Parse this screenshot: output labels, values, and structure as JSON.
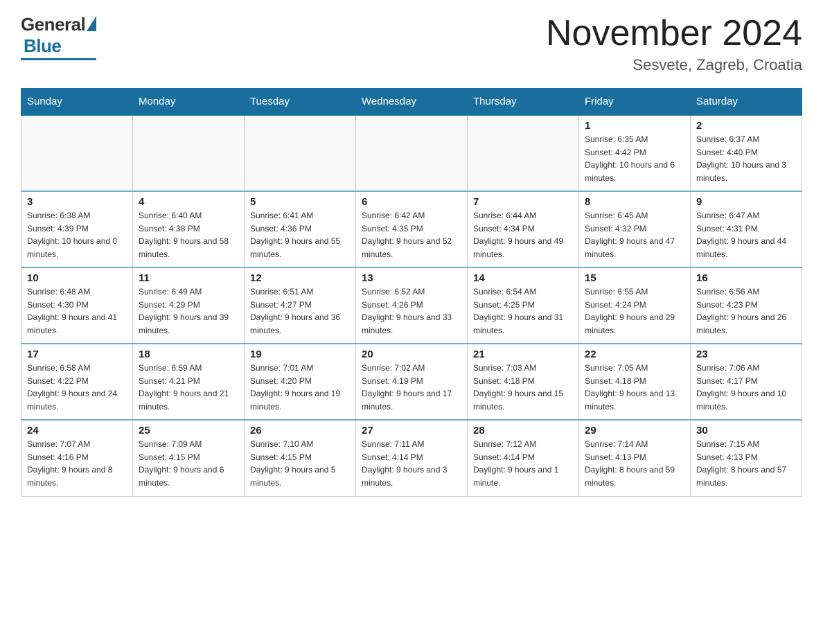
{
  "logo": {
    "general": "General",
    "blue": "Blue"
  },
  "header": {
    "month": "November 2024",
    "location": "Sesvete, Zagreb, Croatia"
  },
  "days_of_week": [
    "Sunday",
    "Monday",
    "Tuesday",
    "Wednesday",
    "Thursday",
    "Friday",
    "Saturday"
  ],
  "weeks": [
    [
      {
        "day": "",
        "info": ""
      },
      {
        "day": "",
        "info": ""
      },
      {
        "day": "",
        "info": ""
      },
      {
        "day": "",
        "info": ""
      },
      {
        "day": "",
        "info": ""
      },
      {
        "day": "1",
        "info": "Sunrise: 6:35 AM\nSunset: 4:42 PM\nDaylight: 10 hours and 6 minutes."
      },
      {
        "day": "2",
        "info": "Sunrise: 6:37 AM\nSunset: 4:40 PM\nDaylight: 10 hours and 3 minutes."
      }
    ],
    [
      {
        "day": "3",
        "info": "Sunrise: 6:38 AM\nSunset: 4:39 PM\nDaylight: 10 hours and 0 minutes."
      },
      {
        "day": "4",
        "info": "Sunrise: 6:40 AM\nSunset: 4:38 PM\nDaylight: 9 hours and 58 minutes."
      },
      {
        "day": "5",
        "info": "Sunrise: 6:41 AM\nSunset: 4:36 PM\nDaylight: 9 hours and 55 minutes."
      },
      {
        "day": "6",
        "info": "Sunrise: 6:42 AM\nSunset: 4:35 PM\nDaylight: 9 hours and 52 minutes."
      },
      {
        "day": "7",
        "info": "Sunrise: 6:44 AM\nSunset: 4:34 PM\nDaylight: 9 hours and 49 minutes."
      },
      {
        "day": "8",
        "info": "Sunrise: 6:45 AM\nSunset: 4:32 PM\nDaylight: 9 hours and 47 minutes."
      },
      {
        "day": "9",
        "info": "Sunrise: 6:47 AM\nSunset: 4:31 PM\nDaylight: 9 hours and 44 minutes."
      }
    ],
    [
      {
        "day": "10",
        "info": "Sunrise: 6:48 AM\nSunset: 4:30 PM\nDaylight: 9 hours and 41 minutes."
      },
      {
        "day": "11",
        "info": "Sunrise: 6:49 AM\nSunset: 4:29 PM\nDaylight: 9 hours and 39 minutes."
      },
      {
        "day": "12",
        "info": "Sunrise: 6:51 AM\nSunset: 4:27 PM\nDaylight: 9 hours and 36 minutes."
      },
      {
        "day": "13",
        "info": "Sunrise: 6:52 AM\nSunset: 4:26 PM\nDaylight: 9 hours and 33 minutes."
      },
      {
        "day": "14",
        "info": "Sunrise: 6:54 AM\nSunset: 4:25 PM\nDaylight: 9 hours and 31 minutes."
      },
      {
        "day": "15",
        "info": "Sunrise: 6:55 AM\nSunset: 4:24 PM\nDaylight: 9 hours and 29 minutes."
      },
      {
        "day": "16",
        "info": "Sunrise: 6:56 AM\nSunset: 4:23 PM\nDaylight: 9 hours and 26 minutes."
      }
    ],
    [
      {
        "day": "17",
        "info": "Sunrise: 6:58 AM\nSunset: 4:22 PM\nDaylight: 9 hours and 24 minutes."
      },
      {
        "day": "18",
        "info": "Sunrise: 6:59 AM\nSunset: 4:21 PM\nDaylight: 9 hours and 21 minutes."
      },
      {
        "day": "19",
        "info": "Sunrise: 7:01 AM\nSunset: 4:20 PM\nDaylight: 9 hours and 19 minutes."
      },
      {
        "day": "20",
        "info": "Sunrise: 7:02 AM\nSunset: 4:19 PM\nDaylight: 9 hours and 17 minutes."
      },
      {
        "day": "21",
        "info": "Sunrise: 7:03 AM\nSunset: 4:18 PM\nDaylight: 9 hours and 15 minutes."
      },
      {
        "day": "22",
        "info": "Sunrise: 7:05 AM\nSunset: 4:18 PM\nDaylight: 9 hours and 13 minutes."
      },
      {
        "day": "23",
        "info": "Sunrise: 7:06 AM\nSunset: 4:17 PM\nDaylight: 9 hours and 10 minutes."
      }
    ],
    [
      {
        "day": "24",
        "info": "Sunrise: 7:07 AM\nSunset: 4:16 PM\nDaylight: 9 hours and 8 minutes."
      },
      {
        "day": "25",
        "info": "Sunrise: 7:09 AM\nSunset: 4:15 PM\nDaylight: 9 hours and 6 minutes."
      },
      {
        "day": "26",
        "info": "Sunrise: 7:10 AM\nSunset: 4:15 PM\nDaylight: 9 hours and 5 minutes."
      },
      {
        "day": "27",
        "info": "Sunrise: 7:11 AM\nSunset: 4:14 PM\nDaylight: 9 hours and 3 minutes."
      },
      {
        "day": "28",
        "info": "Sunrise: 7:12 AM\nSunset: 4:14 PM\nDaylight: 9 hours and 1 minute."
      },
      {
        "day": "29",
        "info": "Sunrise: 7:14 AM\nSunset: 4:13 PM\nDaylight: 8 hours and 59 minutes."
      },
      {
        "day": "30",
        "info": "Sunrise: 7:15 AM\nSunset: 4:13 PM\nDaylight: 8 hours and 57 minutes."
      }
    ]
  ]
}
